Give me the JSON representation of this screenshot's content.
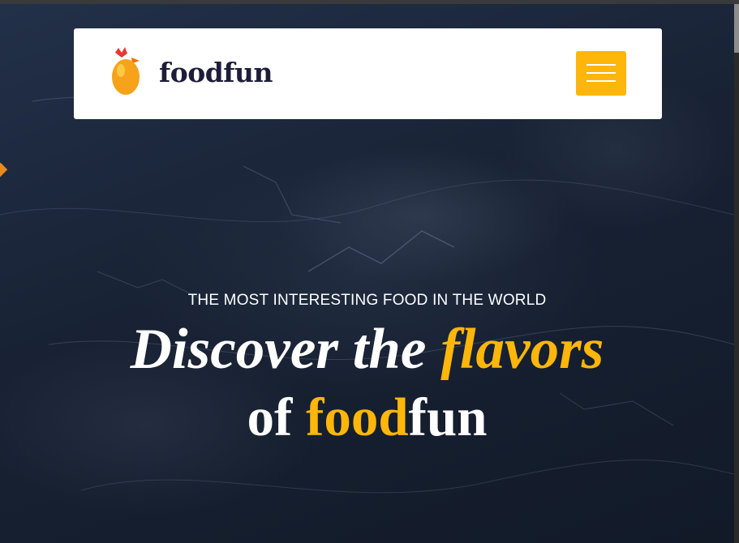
{
  "brand": {
    "name": "foodfun",
    "logo_icon": "egg-chicken-icon"
  },
  "navbar": {
    "menu_icon": "hamburger-menu-icon"
  },
  "hero": {
    "tagline": "THE MOST INTERESTING FOOD IN THE WORLD",
    "headline_line1_part1": "Discover the ",
    "headline_line1_accent": "flavors",
    "headline_line2_part1": "of ",
    "headline_line2_accent": "food",
    "headline_line2_part2": "fun"
  },
  "colors": {
    "accent": "#ffb60a",
    "brand_text": "#1d1d3a",
    "hero_background": "#1b2434",
    "navbar_background": "#ffffff"
  }
}
